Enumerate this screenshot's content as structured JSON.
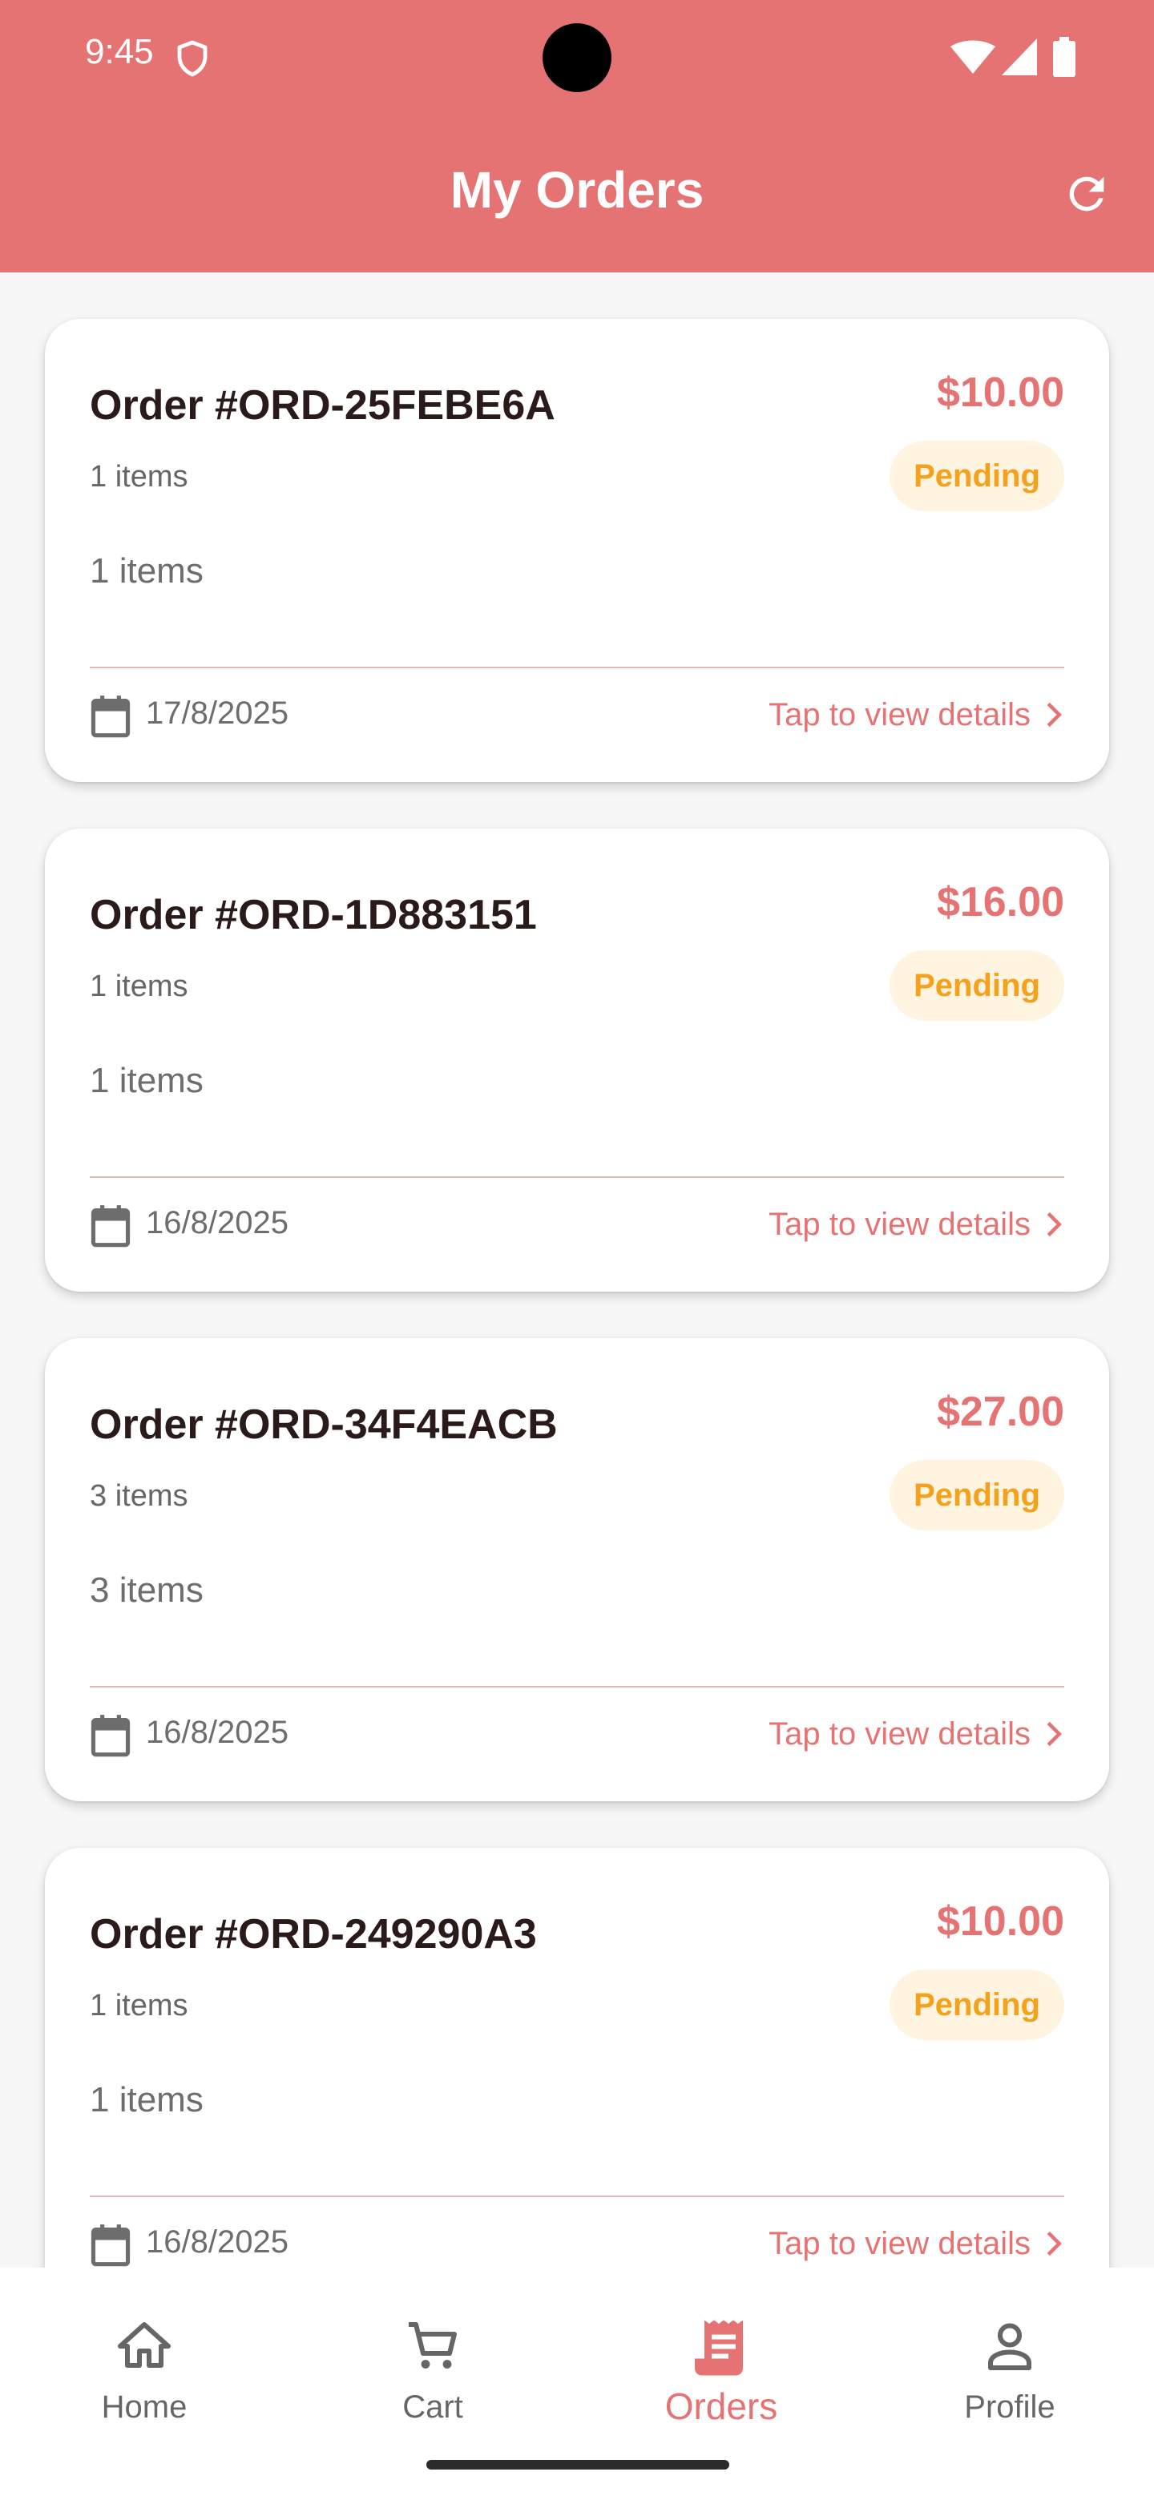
{
  "status_bar": {
    "time": "9:45"
  },
  "header": {
    "title": "My Orders"
  },
  "orders": [
    {
      "id": "Order #ORD-25FEBE6A",
      "price": "$10.00",
      "status": "Pending",
      "items_summary": "1 items",
      "items_text": "1 items",
      "date": "17/8/2025",
      "details_label": "Tap to view details"
    },
    {
      "id": "Order #ORD-1D883151",
      "price": "$16.00",
      "status": "Pending",
      "items_summary": "1 items",
      "items_text": "1 items",
      "date": "16/8/2025",
      "details_label": "Tap to view details"
    },
    {
      "id": "Order #ORD-34F4EACB",
      "price": "$27.00",
      "status": "Pending",
      "items_summary": "3 items",
      "items_text": "3 items",
      "date": "16/8/2025",
      "details_label": "Tap to view details"
    },
    {
      "id": "Order #ORD-249290A3",
      "price": "$10.00",
      "status": "Pending",
      "items_summary": "1 items",
      "items_text": "1 items",
      "date": "16/8/2025",
      "details_label": "Tap to view details"
    }
  ],
  "bottom_nav": [
    {
      "label": "Home",
      "icon": "home-icon",
      "active": false
    },
    {
      "label": "Cart",
      "icon": "cart-icon",
      "active": false
    },
    {
      "label": "Orders",
      "icon": "orders-icon",
      "active": true
    },
    {
      "label": "Profile",
      "icon": "profile-icon",
      "active": false
    }
  ],
  "colors": {
    "accent": "#e57373",
    "pending": "#f6a11b",
    "pending_bg": "#fff4e0"
  }
}
